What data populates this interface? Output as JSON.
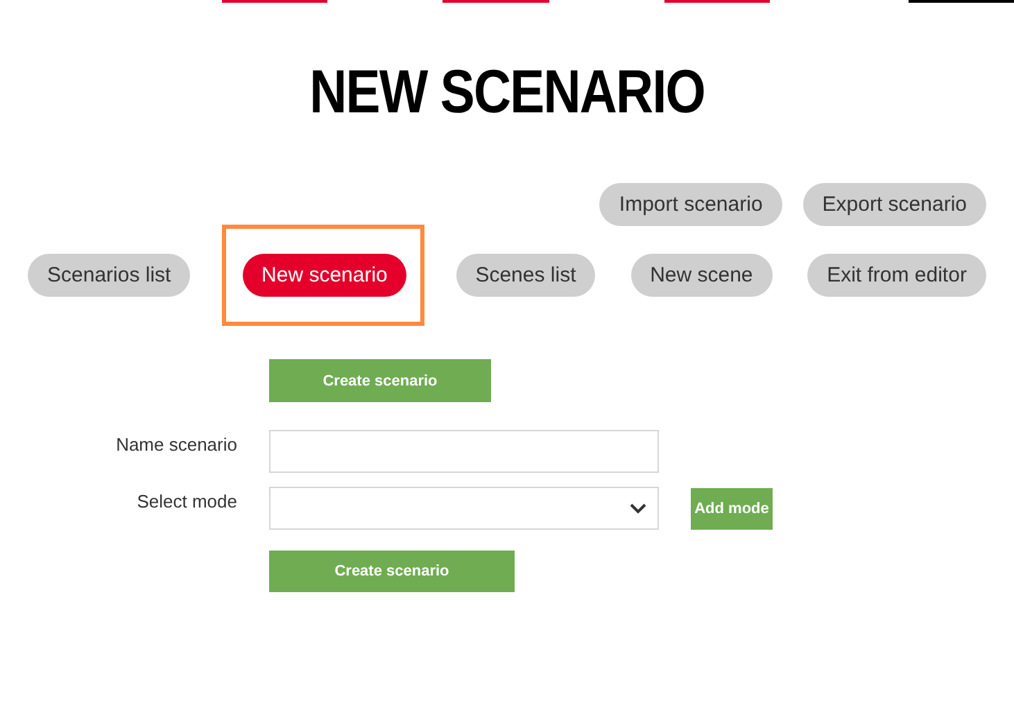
{
  "top_bars": [
    {
      "color": "#e4002b"
    },
    {
      "color": "#e4002b"
    },
    {
      "color": "#e4002b"
    },
    {
      "color": "#000000"
    }
  ],
  "title": "NEW SCENARIO",
  "toolbar_top": [
    {
      "label": "Import scenario",
      "selected": false,
      "highlighted": false
    },
    {
      "label": "Export scenario",
      "selected": false,
      "highlighted": false
    }
  ],
  "toolbar": [
    {
      "label": "Scenarios list",
      "selected": false,
      "highlighted": false
    },
    {
      "label": "New scenario",
      "selected": true,
      "highlighted": true
    },
    {
      "label": "Scenes list",
      "selected": false,
      "highlighted": false
    },
    {
      "label": "New scene",
      "selected": false,
      "highlighted": false
    },
    {
      "label": "Exit from editor",
      "selected": false,
      "highlighted": false
    }
  ],
  "form": {
    "top_button": "Create scenario",
    "name_label": "Name scenario",
    "mode_label": "Select mode",
    "add_mode": "Add mode",
    "submit": "Create scenario"
  }
}
